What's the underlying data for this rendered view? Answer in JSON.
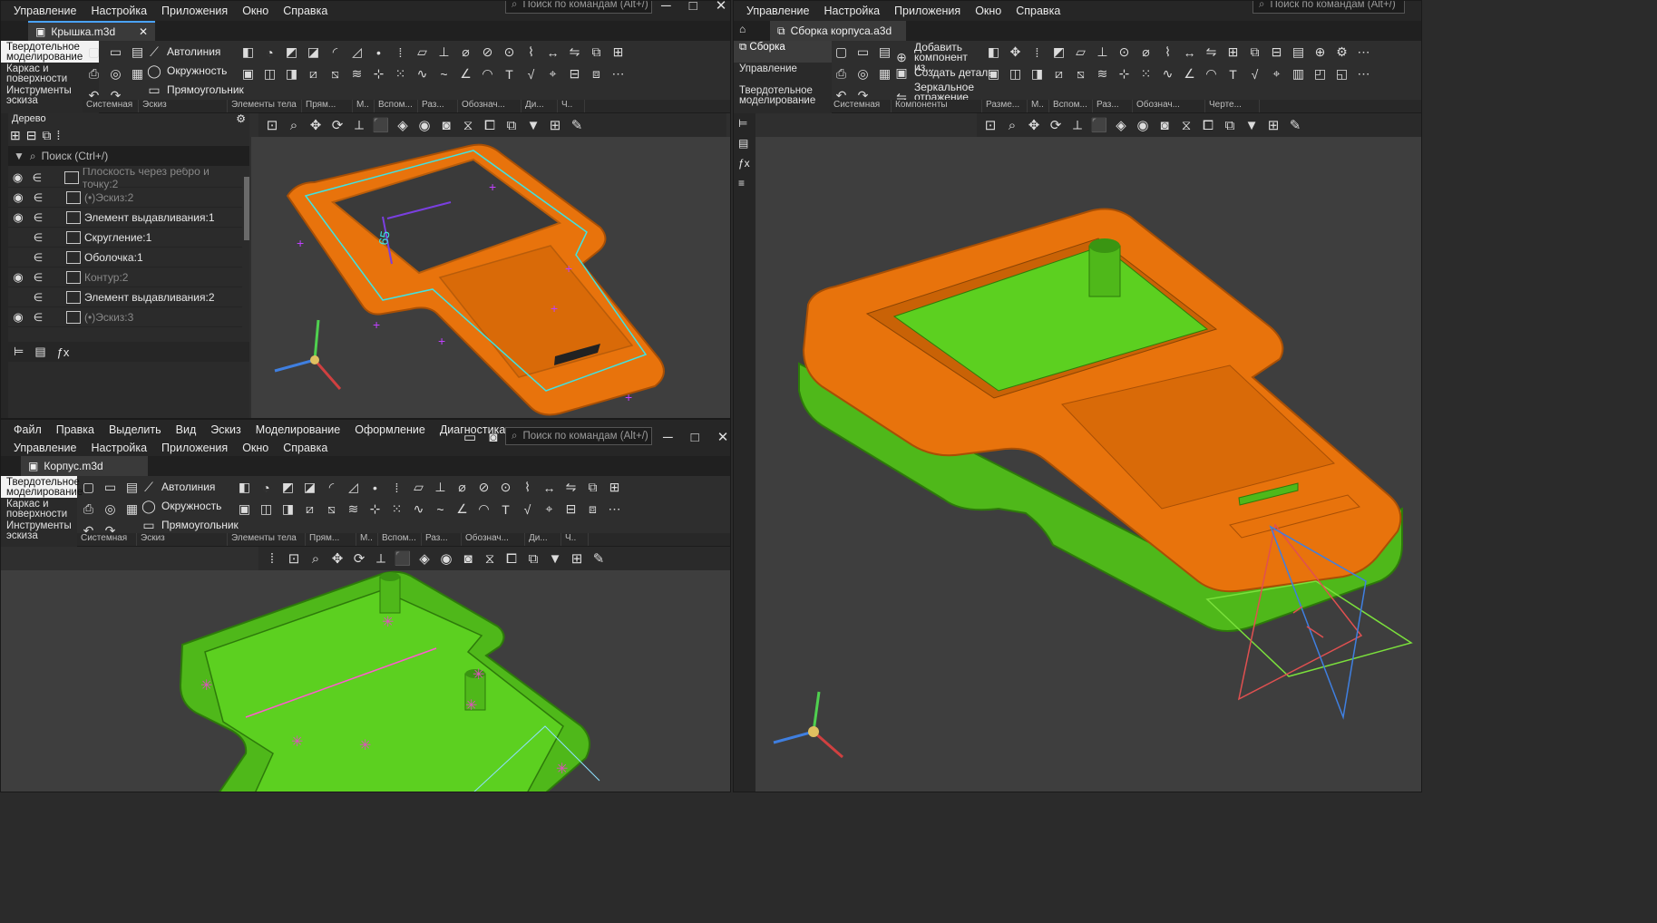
{
  "top_left_window": {
    "menu": [
      "Управление",
      "Настройка",
      "Приложения",
      "Окно",
      "Справка"
    ],
    "search_placeholder": "Поиск по командам (Alt+/)",
    "doc_tab": "Крышка.m3d",
    "ribbon_tabs": [
      "Твердотельное моделирование",
      "Каркас и поверхности",
      "Инструменты эскиза"
    ],
    "commands": [
      "Автолиния",
      "Окружность",
      "Прямоугольник"
    ],
    "groups": [
      "Системная",
      "Эскиз",
      "Элементы тела",
      "Прям...",
      "М..",
      "Вспом...",
      "Раз...",
      "Обознач...",
      "Ди...",
      "Ч.."
    ],
    "tree": {
      "title": "Дерево",
      "search_placeholder": "Поиск (Ctrl+/)",
      "items": [
        {
          "label": "Плоскость через ребро и точку:2",
          "eye": true,
          "muted": true
        },
        {
          "label": "(•)Эскиз:2",
          "eye": true,
          "muted": true
        },
        {
          "label": "Элемент выдавливания:1",
          "eye": true,
          "muted": false
        },
        {
          "label": "Скругление:1",
          "eye": false,
          "muted": false
        },
        {
          "label": "Оболочка:1",
          "eye": false,
          "muted": false
        },
        {
          "label": "Контур:2",
          "eye": true,
          "muted": true
        },
        {
          "label": "Элемент выдавливания:2",
          "eye": false,
          "muted": false
        },
        {
          "label": "(•)Эскиз:3",
          "eye": true,
          "muted": true
        }
      ]
    },
    "dimension_label": "65"
  },
  "bottom_left_window": {
    "menu": [
      "Файл",
      "Правка",
      "Выделить",
      "Вид",
      "Эскиз",
      "Моделирование",
      "Оформление",
      "Диагностика"
    ],
    "menu2": [
      "Управление",
      "Настройка",
      "Приложения",
      "Окно",
      "Справка"
    ],
    "search_placeholder": "Поиск по командам (Alt+/)",
    "doc_tab": "Корпус.m3d",
    "ribbon_tabs": [
      "Твердотельное моделирование",
      "Каркас и поверхности",
      "Инструменты эскиза"
    ],
    "commands": [
      "Автолиния",
      "Окружность",
      "Прямоугольник"
    ],
    "groups": [
      "Системная",
      "Эскиз",
      "Элементы тела",
      "Прям...",
      "М..",
      "Вспом...",
      "Раз...",
      "Обознач...",
      "Ди...",
      "Ч.."
    ]
  },
  "right_window": {
    "menu": [
      "Управление",
      "Настройка",
      "Приложения",
      "Окно",
      "Справка"
    ],
    "search_placeholder": "Поиск по командам (Alt+/)",
    "doc_tab": "Сборка корпуса.a3d",
    "ribbon_tabs": [
      "Сборка",
      "Управление",
      "Твердотельное моделирование"
    ],
    "commands": [
      "Добавить компонент из...",
      "Создать деталь",
      "Зеркальное отражение ко..."
    ],
    "groups": [
      "Системная",
      "Компоненты",
      "Разме...",
      "М..",
      "Вспом...",
      "Раз...",
      "Обознач...",
      "Черте..."
    ]
  },
  "colors": {
    "orange": "#e8730c",
    "green": "#4fb81a",
    "cyan": "#3fe3e3",
    "accent": "#4aa3ff"
  }
}
